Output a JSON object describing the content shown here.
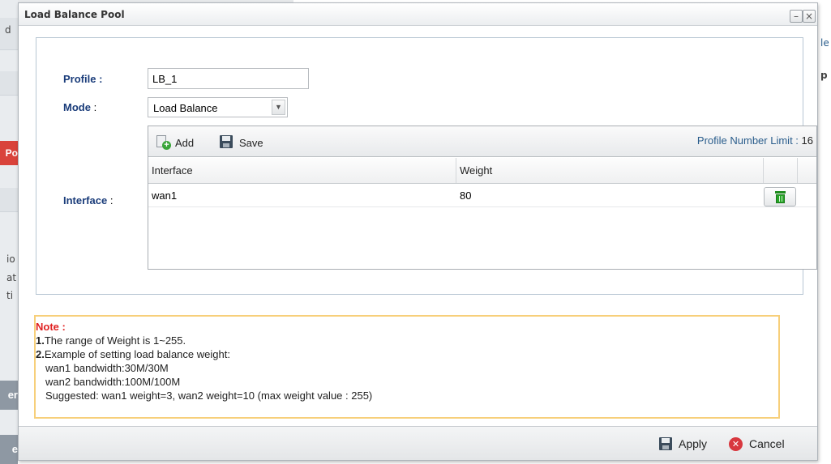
{
  "background": {
    "frag_d": "d",
    "frag_po": "Po",
    "frag_io": "io",
    "frag_at": "at",
    "frag_ti": "ti",
    "frag_er": "er",
    "frag_e": "e",
    "frag_le": "le",
    "frag_pi": "p l"
  },
  "dialog": {
    "title": "Load Balance Pool",
    "minimize_glyph": "–",
    "close_glyph": "×"
  },
  "form": {
    "profile_label": "Profile :",
    "profile_value": "LB_1",
    "mode_label": "Mode",
    "mode_colon": " :",
    "mode_value": "Load Balance",
    "interface_label": "Interface",
    "interface_colon": " :"
  },
  "grid": {
    "add_label": "Add",
    "save_label": "Save",
    "limit_label": "Profile Number Limit :",
    "limit_value": "16",
    "columns": [
      "Interface",
      "Weight"
    ],
    "rows": [
      {
        "interface": "wan1",
        "weight": "80"
      }
    ]
  },
  "note": {
    "title": "Note :",
    "line1_num": "1.",
    "line1": "The range of Weight is 1~255.",
    "line2_num": "2.",
    "line2": "Example of setting load balance weight:",
    "line3": "wan1 bandwidth:30M/30M",
    "line4": "wan2 bandwidth:100M/100M",
    "line5": "Suggested: wan1 weight=3, wan2 weight=10 (max weight value : 255)"
  },
  "footer": {
    "apply_label": "Apply",
    "cancel_label": "Cancel"
  },
  "colors": {
    "label_blue": "#1a3c7a",
    "note_red": "#e02020",
    "note_border": "#f7cf7a",
    "accent_green": "#27a527"
  }
}
